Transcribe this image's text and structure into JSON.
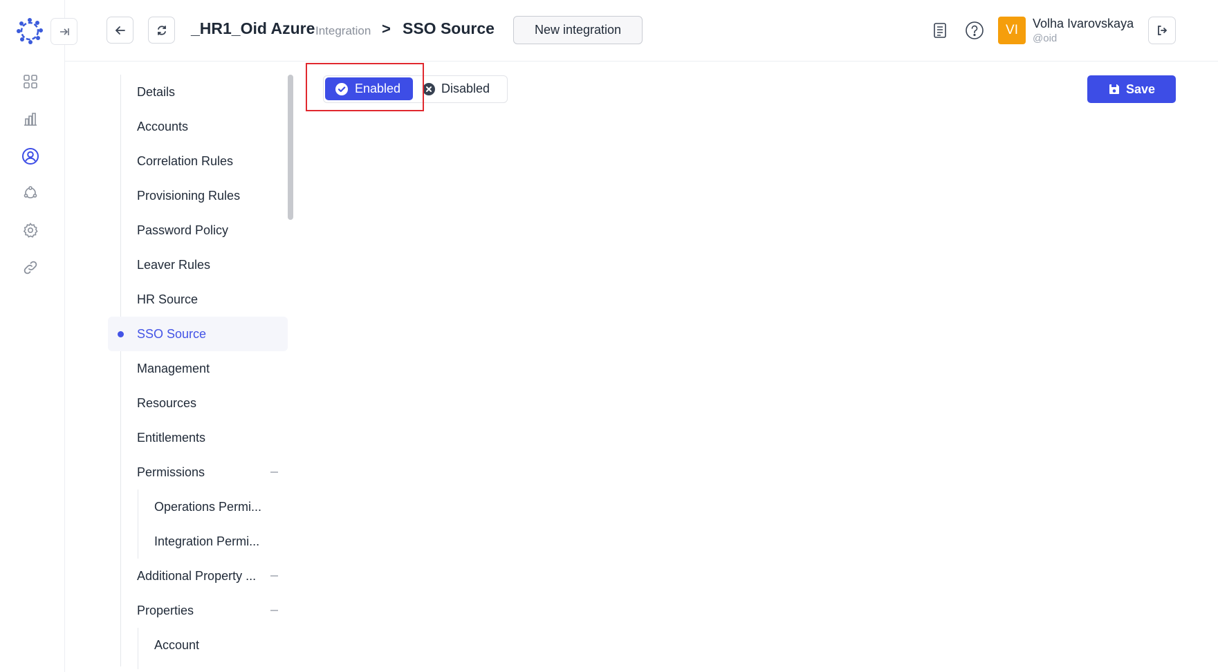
{
  "header": {
    "integration_name": "_HR1_Oid Azure",
    "integration_type": "Integration",
    "separator": ">",
    "current_section": "SSO Source",
    "new_integration_label": "New integration"
  },
  "user": {
    "initials": "VI",
    "name": "Volha Ivarovskaya",
    "handle": "@oid"
  },
  "rail_icons": [
    "dashboard-icon",
    "reports-icon",
    "user-circle-icon",
    "network-icon",
    "settings-icon",
    "link-icon"
  ],
  "sections": {
    "details": "Details",
    "accounts": "Accounts",
    "correlation_rules": "Correlation Rules",
    "provisioning_rules": "Provisioning Rules",
    "password_policy": "Password Policy",
    "leaver_rules": "Leaver Rules",
    "hr_source": "HR Source",
    "sso_source": "SSO Source",
    "management": "Management",
    "resources": "Resources",
    "entitlements": "Entitlements",
    "permissions": "Permissions",
    "operations_permissions": "Operations Permi...",
    "integration_permissions": "Integration Permi...",
    "additional_property": "Additional Property ...",
    "properties": "Properties",
    "account": "Account"
  },
  "toggle": {
    "enabled_label": "Enabled",
    "disabled_label": "Disabled",
    "selected": "Enabled"
  },
  "actions": {
    "save_label": "Save"
  },
  "colors": {
    "primary": "#3d4de6",
    "avatar": "#f59e0b",
    "highlight": "#e0282e"
  }
}
